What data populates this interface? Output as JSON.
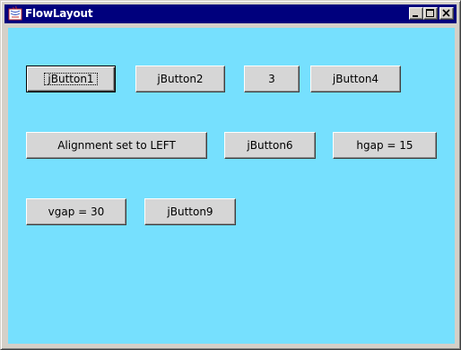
{
  "window": {
    "title": "FlowLayout",
    "background_color": "#76e0fe",
    "titlebar_color": "#00007d"
  },
  "title_bar_buttons": {
    "minimize_icon": "minimize-icon",
    "maximize_icon": "maximize-icon",
    "close_icon": "close-icon"
  },
  "buttons": [
    {
      "label": "jButton1",
      "focused": true
    },
    {
      "label": "jButton2"
    },
    {
      "label": "3"
    },
    {
      "label": "jButton4"
    },
    {
      "label": "Alignment set to LEFT"
    },
    {
      "label": "jButton6"
    },
    {
      "label": "hgap = 15"
    },
    {
      "label": "vgap = 30"
    },
    {
      "label": "jButton9"
    }
  ]
}
